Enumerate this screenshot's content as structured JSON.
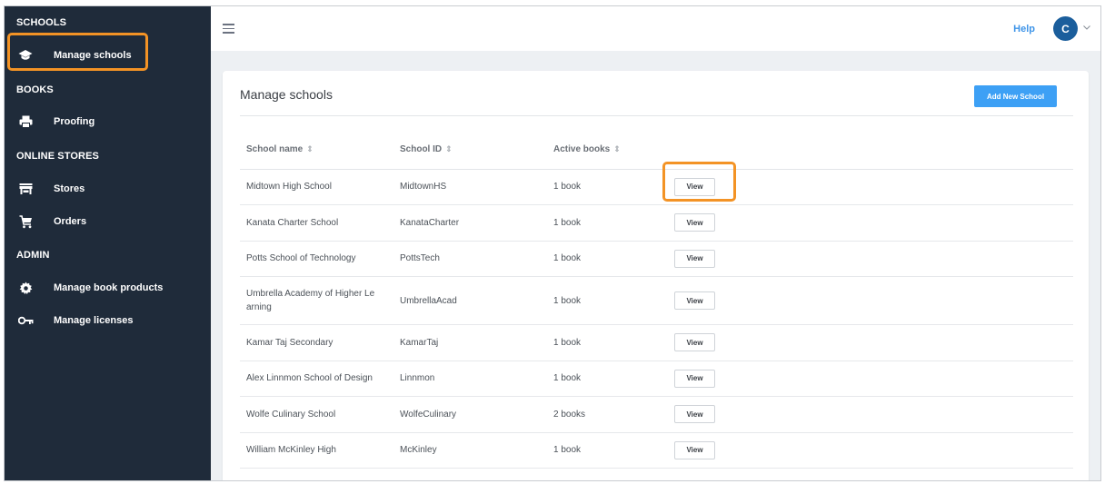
{
  "sidebar": {
    "sections": [
      {
        "title": "SCHOOLS",
        "items": [
          {
            "label": "Manage schools",
            "icon": "graduation-cap-icon"
          }
        ]
      },
      {
        "title": "BOOKS",
        "items": [
          {
            "label": "Proofing",
            "icon": "printer-icon"
          }
        ]
      },
      {
        "title": "ONLINE STORES",
        "items": [
          {
            "label": "Stores",
            "icon": "store-icon"
          },
          {
            "label": "Orders",
            "icon": "cart-icon"
          }
        ]
      },
      {
        "title": "ADMIN",
        "items": [
          {
            "label": "Manage book products",
            "icon": "gear-icon"
          },
          {
            "label": "Manage licenses",
            "icon": "key-icon"
          }
        ]
      }
    ]
  },
  "topbar": {
    "menu_icon": "hamburger-icon",
    "help_label": "Help",
    "avatar_initial": "C"
  },
  "main": {
    "title": "Manage schools",
    "add_button_label": "Add New School",
    "columns": [
      "School name",
      "School ID",
      "Active books"
    ],
    "sort_glyph": "⇕",
    "view_label": "View",
    "rows": [
      {
        "name": "Midtown High School",
        "id": "MidtownHS",
        "books": "1 book"
      },
      {
        "name": "Kanata Charter School",
        "id": "KanataCharter",
        "books": "1 book"
      },
      {
        "name": "Potts School of Technology",
        "id": "PottsTech",
        "books": "1 book"
      },
      {
        "name": "Umbrella Academy of Higher Le arning",
        "id": "UmbrellaAcad",
        "books": "1 book"
      },
      {
        "name": "Kamar Taj Secondary",
        "id": "KamarTaj",
        "books": "1 book"
      },
      {
        "name": "Alex Linnmon School of Design",
        "id": "Linnmon",
        "books": "1 book"
      },
      {
        "name": "Wolfe Culinary School",
        "id": "WolfeCulinary",
        "books": "2 books"
      },
      {
        "name": "William McKinley High",
        "id": "McKinley",
        "books": "1 book"
      }
    ]
  },
  "colors": {
    "sidebar_bg": "#1f2b3a",
    "accent": "#3da0f5",
    "highlight": "#f39325",
    "avatar": "#1b5e9c"
  }
}
